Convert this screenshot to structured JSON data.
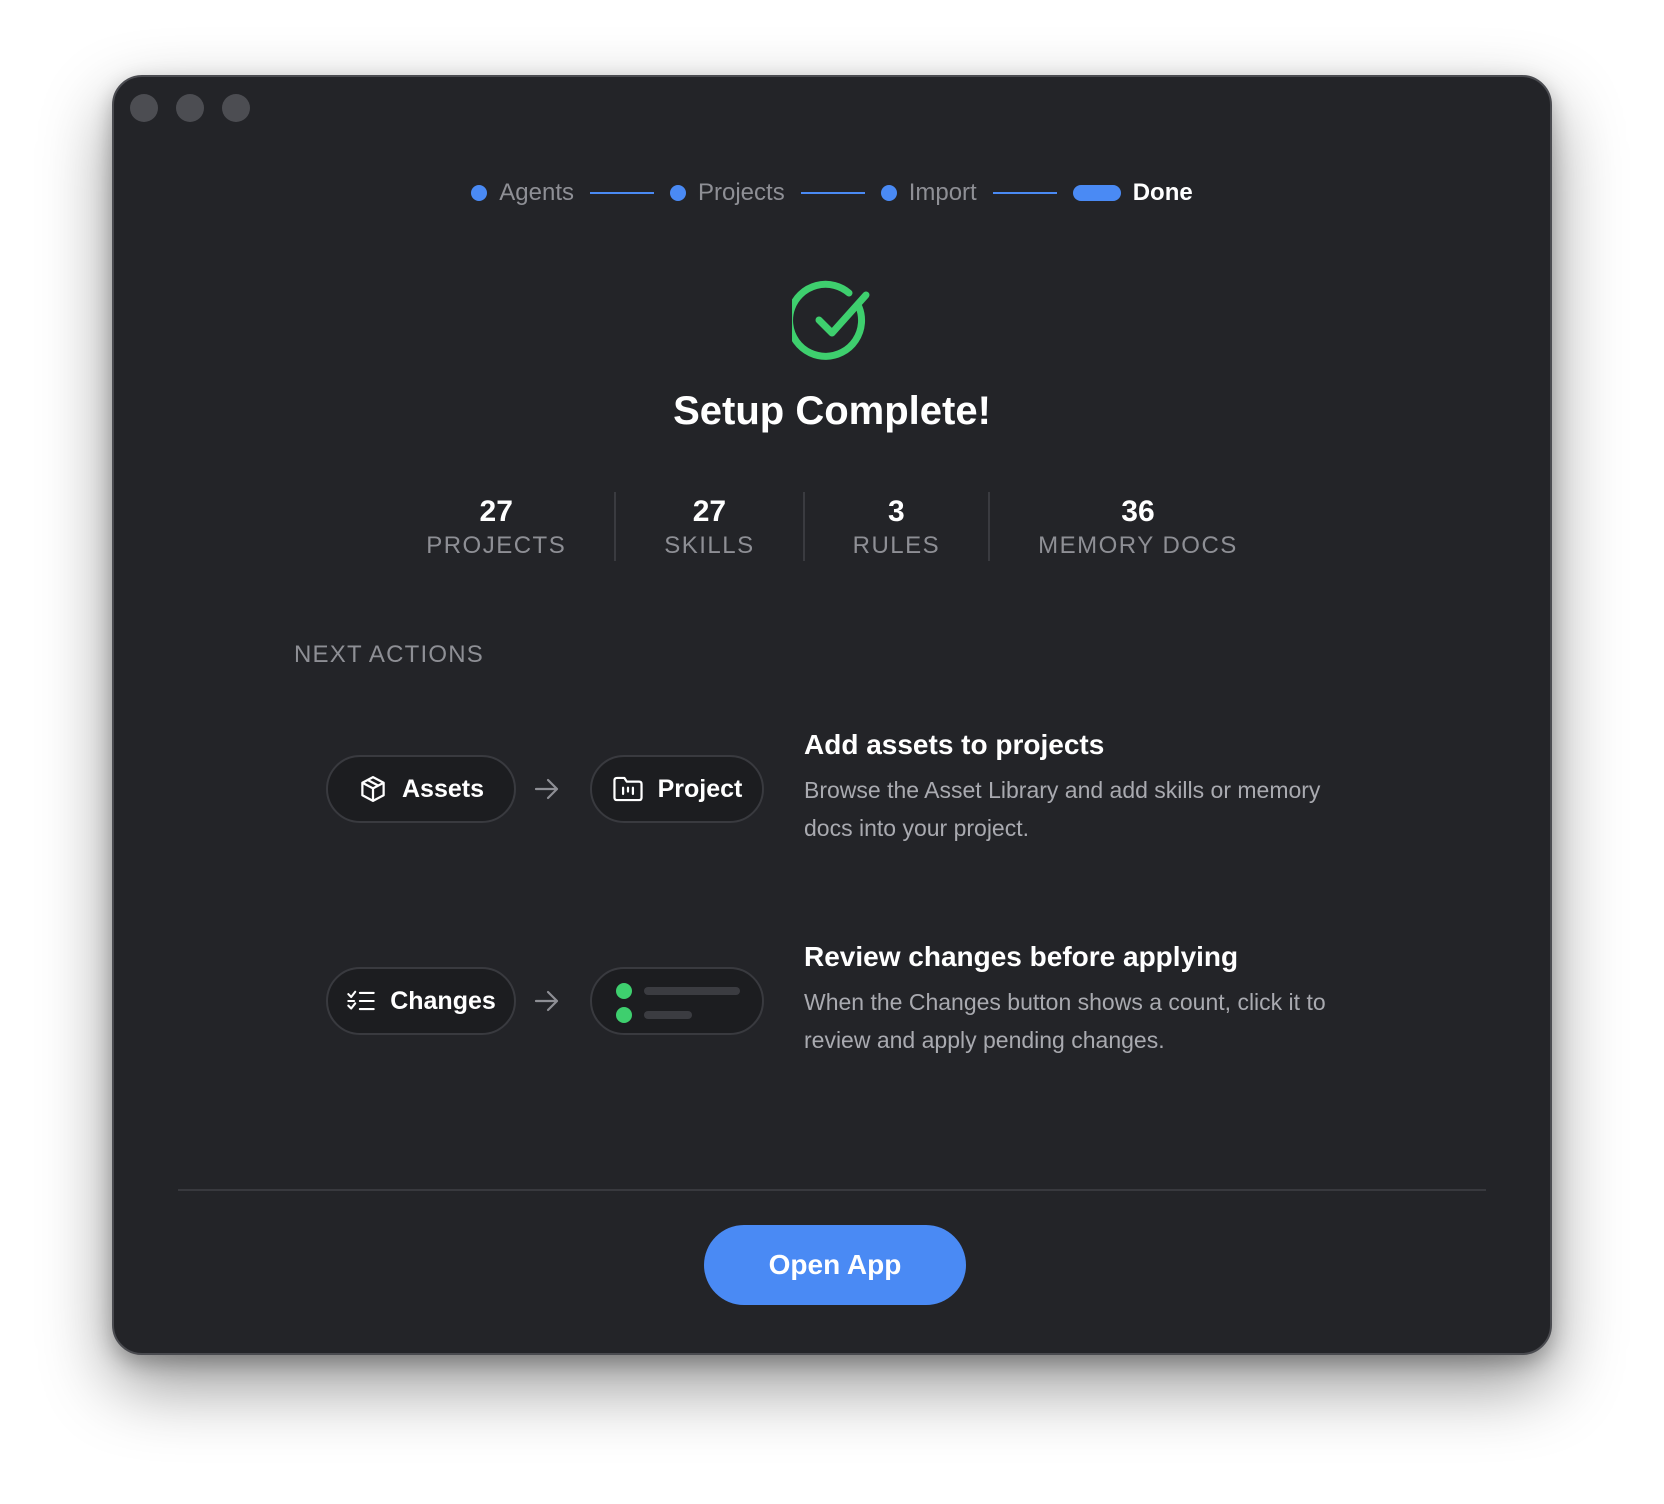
{
  "stepper": {
    "steps": [
      {
        "label": "Agents",
        "state": "complete"
      },
      {
        "label": "Projects",
        "state": "complete"
      },
      {
        "label": "Import",
        "state": "complete"
      },
      {
        "label": "Done",
        "state": "current"
      }
    ]
  },
  "success_icon": "check-circle-icon",
  "title": "Setup Complete!",
  "stats": [
    {
      "value": "27",
      "label": "PROJECTS"
    },
    {
      "value": "27",
      "label": "SKILLS"
    },
    {
      "value": "3",
      "label": "RULES"
    },
    {
      "value": "36",
      "label": "MEMORY DOCS"
    }
  ],
  "next_actions": {
    "heading": "NEXT ACTIONS",
    "items": [
      {
        "from_chip": {
          "icon": "cube-icon",
          "label": "Assets"
        },
        "to_chip": {
          "icon": "folder-icon",
          "label": "Project"
        },
        "title": "Add assets to projects",
        "description": "Browse the Asset Library and add skills or memory docs into your project."
      },
      {
        "from_chip": {
          "icon": "checklist-icon",
          "label": "Changes"
        },
        "to_chip": {
          "icon": "pending-changes-preview",
          "label": ""
        },
        "title": "Review changes before applying",
        "description": "When the Changes button shows a count, click it to review and apply pending changes."
      }
    ]
  },
  "footer": {
    "primary_button": "Open App"
  },
  "colors": {
    "accent": "#4a8af4",
    "success": "#3ecf6e",
    "window_bg": "#232428",
    "muted_text": "#8e8f95"
  }
}
